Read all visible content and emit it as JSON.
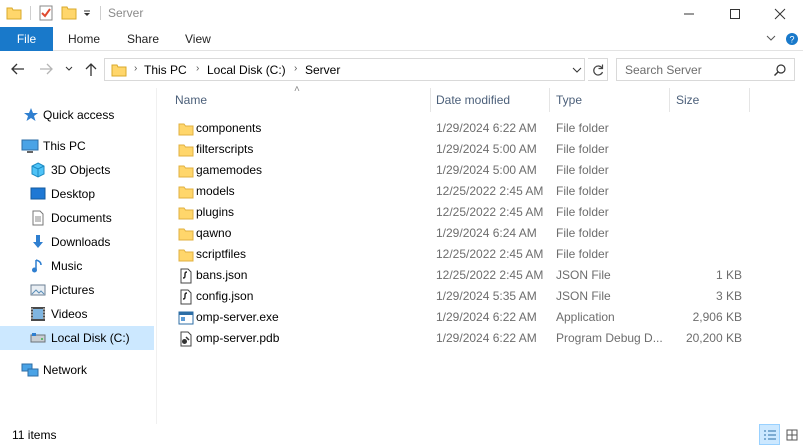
{
  "window": {
    "title": "Server",
    "controls": [
      "minimize",
      "maximize",
      "close"
    ]
  },
  "ribbon": {
    "file_tab": "File",
    "tabs": [
      "Home",
      "Share",
      "View"
    ]
  },
  "address": {
    "crumbs": [
      "This PC",
      "Local Disk (C:)",
      "Server"
    ],
    "search_placeholder": "Search Server"
  },
  "sidebar": {
    "items": [
      {
        "label": "Quick access",
        "icon": "star-icon"
      },
      {
        "label": "This PC",
        "icon": "computer-icon"
      },
      {
        "label": "3D Objects",
        "icon": "cube-icon"
      },
      {
        "label": "Desktop",
        "icon": "desktop-icon"
      },
      {
        "label": "Documents",
        "icon": "document-icon"
      },
      {
        "label": "Downloads",
        "icon": "download-icon"
      },
      {
        "label": "Music",
        "icon": "music-icon"
      },
      {
        "label": "Pictures",
        "icon": "pictures-icon"
      },
      {
        "label": "Videos",
        "icon": "video-icon"
      },
      {
        "label": "Local Disk (C:)",
        "icon": "drive-icon",
        "selected": true
      },
      {
        "label": "Network",
        "icon": "network-icon"
      }
    ]
  },
  "columns": {
    "name": "Name",
    "date": "Date modified",
    "type": "Type",
    "size": "Size"
  },
  "files": [
    {
      "name": "components",
      "date": "1/29/2024 6:22 AM",
      "type": "File folder",
      "size": "",
      "icon": "folder-icon"
    },
    {
      "name": "filterscripts",
      "date": "1/29/2024 5:00 AM",
      "type": "File folder",
      "size": "",
      "icon": "folder-icon"
    },
    {
      "name": "gamemodes",
      "date": "1/29/2024 5:00 AM",
      "type": "File folder",
      "size": "",
      "icon": "folder-icon"
    },
    {
      "name": "models",
      "date": "12/25/2022 2:45 AM",
      "type": "File folder",
      "size": "",
      "icon": "folder-icon"
    },
    {
      "name": "plugins",
      "date": "12/25/2022 2:45 AM",
      "type": "File folder",
      "size": "",
      "icon": "folder-icon"
    },
    {
      "name": "qawno",
      "date": "1/29/2024 6:24 AM",
      "type": "File folder",
      "size": "",
      "icon": "folder-icon"
    },
    {
      "name": "scriptfiles",
      "date": "12/25/2022 2:45 AM",
      "type": "File folder",
      "size": "",
      "icon": "folder-icon"
    },
    {
      "name": "bans.json",
      "date": "12/25/2022 2:45 AM",
      "type": "JSON File",
      "size": "1 KB",
      "icon": "json-file-icon"
    },
    {
      "name": "config.json",
      "date": "1/29/2024 5:35 AM",
      "type": "JSON File",
      "size": "3 KB",
      "icon": "json-file-icon"
    },
    {
      "name": "omp-server.exe",
      "date": "1/29/2024 6:22 AM",
      "type": "Application",
      "size": "2,906 KB",
      "icon": "application-icon"
    },
    {
      "name": "omp-server.pdb",
      "date": "1/29/2024 6:22 AM",
      "type": "Program Debug D...",
      "size": "20,200 KB",
      "icon": "pdb-file-icon"
    }
  ],
  "status": {
    "item_count": "11 items"
  },
  "colors": {
    "accent": "#1979ca",
    "selection": "#cce8ff",
    "folder": "#ffd66b",
    "header_text": "#4c607a"
  }
}
